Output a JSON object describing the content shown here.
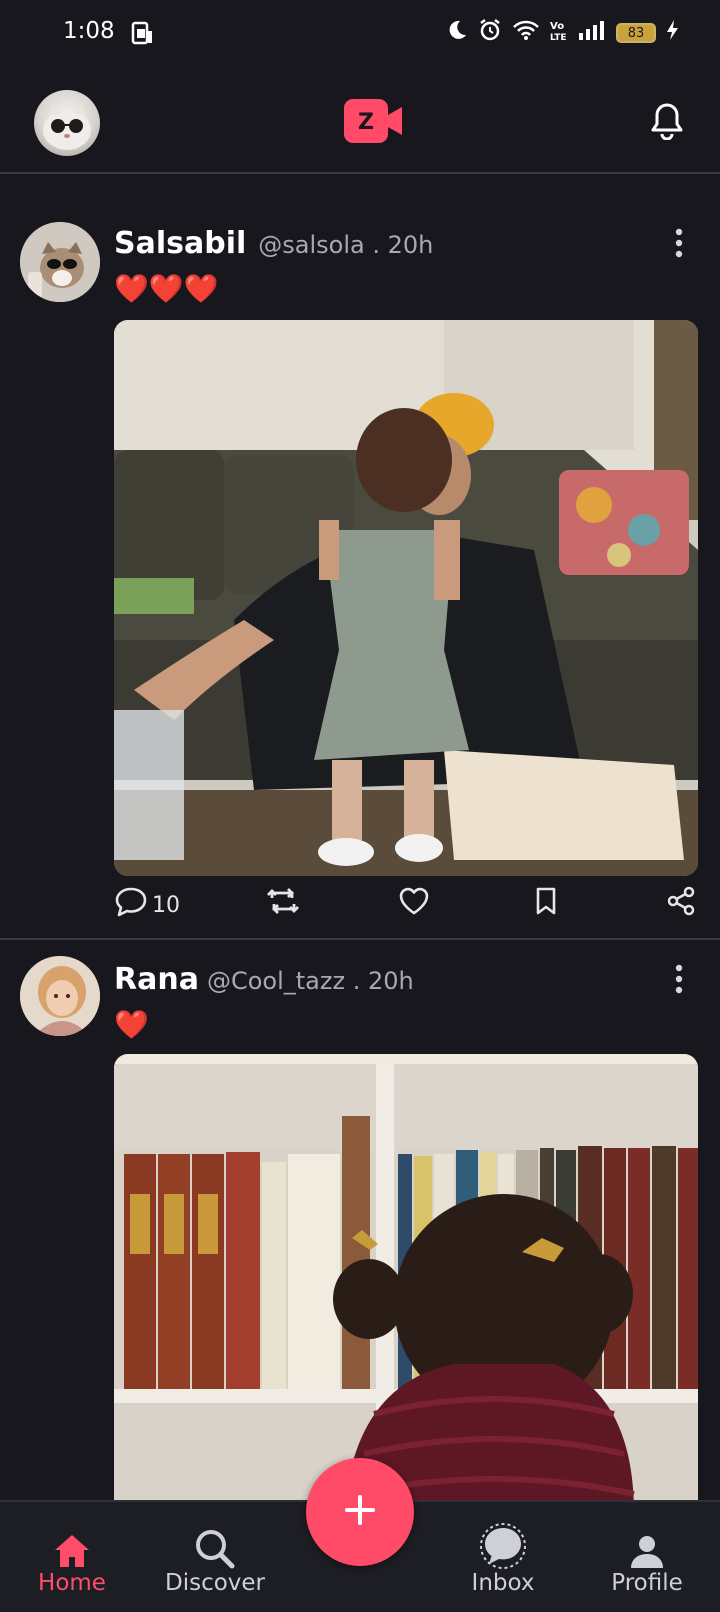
{
  "status_bar": {
    "time": "1:08",
    "battery": "83"
  },
  "colors": {
    "background": "#17171d",
    "accent": "#ff4a68",
    "muted_text": "#a8a8b0"
  },
  "header": {
    "logo_letter": "Z"
  },
  "posts": [
    {
      "name": "Salsabil",
      "handle": "@salsola . 20h",
      "text": "❤️❤️❤️",
      "comments": "10"
    },
    {
      "name": "Rana",
      "handle": "@Cool_tazz . 20h",
      "text": "❤️"
    }
  ],
  "nav": {
    "home": "Home",
    "discover": "Discover",
    "inbox": "Inbox",
    "profile": "Profile"
  },
  "icons": [
    "sim-icon",
    "moon-icon",
    "alarm-icon",
    "wifi-icon",
    "volte-icon",
    "signal-icon",
    "battery-icon",
    "charging-icon",
    "bell-icon",
    "more-icon",
    "comment-icon",
    "repost-icon",
    "heart-icon",
    "bookmark-icon",
    "share-icon",
    "home-icon",
    "search-icon",
    "chat-icon",
    "person-icon",
    "plus-icon"
  ]
}
